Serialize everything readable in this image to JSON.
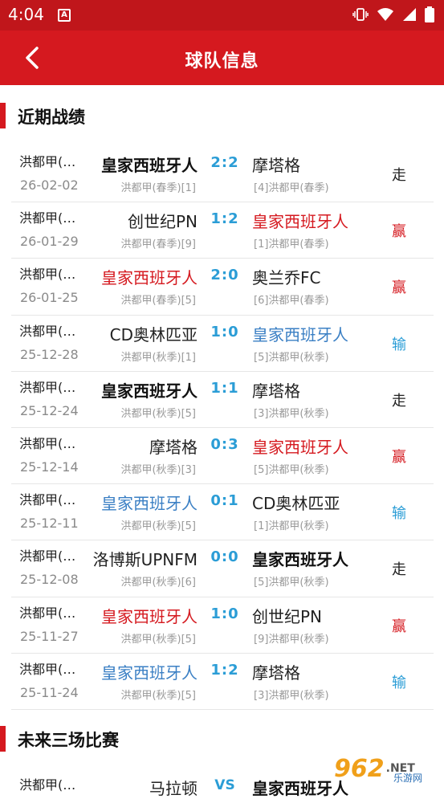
{
  "status": {
    "time": "4:04",
    "a_badge": "A"
  },
  "header": {
    "title": "球队信息"
  },
  "recent": {
    "title": "近期战绩",
    "matches": [
      {
        "league": "洪都甲(…",
        "date": "26-02-02",
        "home": "皇家西班牙人",
        "home_rank": "洪都甲(春季)[1]",
        "score": "2:2",
        "away": "摩塔格",
        "away_rank": "[4]洪都甲(春季)",
        "result": "走",
        "home_style": "bold",
        "away_style": "normal",
        "result_style": "draw"
      },
      {
        "league": "洪都甲(…",
        "date": "26-01-29",
        "home": "创世纪PN",
        "home_rank": "洪都甲(春季)[9]",
        "score": "1:2",
        "away": "皇家西班牙人",
        "away_rank": "[1]洪都甲(春季)",
        "result": "赢",
        "home_style": "normal",
        "away_style": "red",
        "result_style": "win"
      },
      {
        "league": "洪都甲(…",
        "date": "26-01-25",
        "home": "皇家西班牙人",
        "home_rank": "洪都甲(春季)[5]",
        "score": "2:0",
        "away": "奥兰乔FC",
        "away_rank": "[6]洪都甲(春季)",
        "result": "赢",
        "home_style": "red",
        "away_style": "normal",
        "result_style": "win"
      },
      {
        "league": "洪都甲(…",
        "date": "25-12-28",
        "home": "CD奥林匹亚",
        "home_rank": "洪都甲(秋季)[1]",
        "score": "1:0",
        "away": "皇家西班牙人",
        "away_rank": "[5]洪都甲(秋季)",
        "result": "输",
        "home_style": "normal",
        "away_style": "blue",
        "result_style": "lose"
      },
      {
        "league": "洪都甲(…",
        "date": "25-12-24",
        "home": "皇家西班牙人",
        "home_rank": "洪都甲(秋季)[5]",
        "score": "1:1",
        "away": "摩塔格",
        "away_rank": "[3]洪都甲(秋季)",
        "result": "走",
        "home_style": "bold",
        "away_style": "normal",
        "result_style": "draw"
      },
      {
        "league": "洪都甲(…",
        "date": "25-12-14",
        "home": "摩塔格",
        "home_rank": "洪都甲(秋季)[3]",
        "score": "0:3",
        "away": "皇家西班牙人",
        "away_rank": "[5]洪都甲(秋季)",
        "result": "赢",
        "home_style": "normal",
        "away_style": "red",
        "result_style": "win"
      },
      {
        "league": "洪都甲(…",
        "date": "25-12-11",
        "home": "皇家西班牙人",
        "home_rank": "洪都甲(秋季)[5]",
        "score": "0:1",
        "away": "CD奥林匹亚",
        "away_rank": "[1]洪都甲(秋季)",
        "result": "输",
        "home_style": "blue",
        "away_style": "normal",
        "result_style": "lose"
      },
      {
        "league": "洪都甲(…",
        "date": "25-12-08",
        "home": "洛博斯UPNFM",
        "home_rank": "洪都甲(秋季)[6]",
        "score": "0:0",
        "away": "皇家西班牙人",
        "away_rank": "[5]洪都甲(秋季)",
        "result": "走",
        "home_style": "normal",
        "away_style": "bold",
        "result_style": "draw"
      },
      {
        "league": "洪都甲(…",
        "date": "25-11-27",
        "home": "皇家西班牙人",
        "home_rank": "洪都甲(秋季)[5]",
        "score": "1:0",
        "away": "创世纪PN",
        "away_rank": "[9]洪都甲(秋季)",
        "result": "赢",
        "home_style": "red",
        "away_style": "normal",
        "result_style": "win"
      },
      {
        "league": "洪都甲(…",
        "date": "25-11-24",
        "home": "皇家西班牙人",
        "home_rank": "洪都甲(秋季)[5]",
        "score": "1:2",
        "away": "摩塔格",
        "away_rank": "[3]洪都甲(秋季)",
        "result": "输",
        "home_style": "blue",
        "away_style": "normal",
        "result_style": "lose"
      }
    ]
  },
  "future": {
    "title": "未来三场比赛",
    "matches": [
      {
        "league": "洪都甲(…",
        "home": "马拉顿",
        "vs": "VS",
        "away": "皇家西班牙人"
      }
    ]
  },
  "watermark": {
    "logo": "962",
    "net": ".NET",
    "sub": "乐游网"
  },
  "colors": {
    "brand_red": "#d5191f",
    "score_blue": "#2b9dd6",
    "lose_blue": "#3a7fc4"
  },
  "icons": {
    "back": "chevron-left-icon",
    "vibrate": "vibrate-icon",
    "wifi": "wifi-icon",
    "signal": "signal-icon",
    "battery": "battery-icon"
  }
}
